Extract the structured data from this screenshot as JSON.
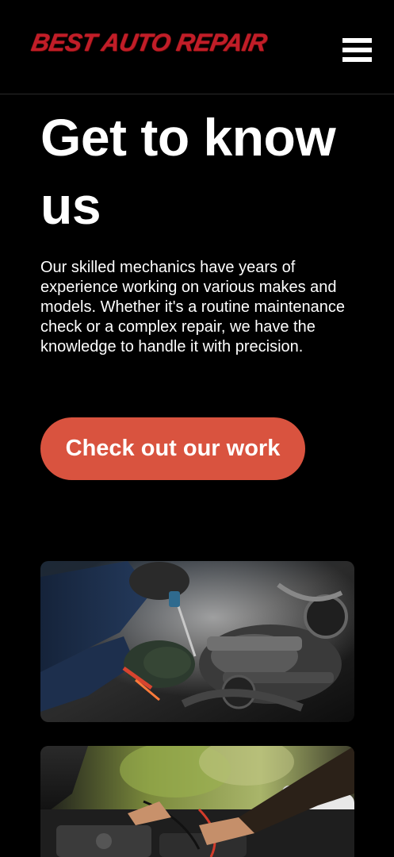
{
  "header": {
    "logo_text": "BEST AUTO REPAIR",
    "menu_icon": "hamburger-menu-icon"
  },
  "hero": {
    "title": "Get to know us",
    "body": "Our skilled mechanics have years of experience working on various makes and models. Whether it's a routine maintenance check or a complex repair, we have the knowledge to handle it with precision.",
    "cta_label": "Check out our work"
  },
  "gallery": {
    "images": [
      {
        "subject": "mechanic-working-on-engine-photo"
      },
      {
        "subject": "mechanic-testing-battery-photo"
      }
    ]
  },
  "colors": {
    "background": "#000000",
    "accent": "#d9533f",
    "logo": "#c11d28",
    "text": "#ffffff"
  }
}
